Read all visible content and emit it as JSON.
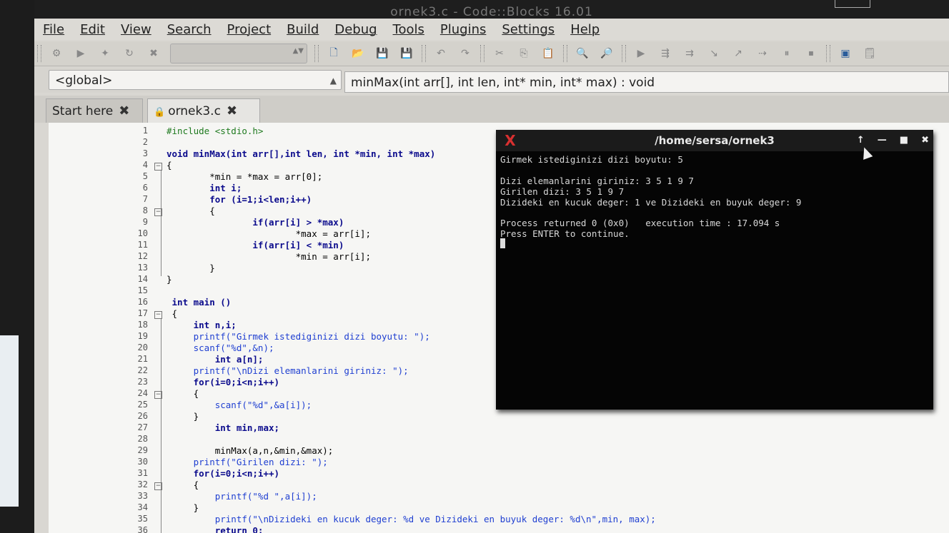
{
  "window": {
    "title": "ornek3.c - Code::Blocks 16.01"
  },
  "menu": [
    "File",
    "Edit",
    "View",
    "Search",
    "Project",
    "Build",
    "Debug",
    "Tools",
    "Plugins",
    "Settings",
    "Help"
  ],
  "scope": {
    "global": "<global>",
    "function": "minMax(int arr[], int len, int* min, int* max) : void"
  },
  "tabs": [
    {
      "label": "Start here"
    },
    {
      "label": "ornek3.c"
    }
  ],
  "code_lines": [
    "#include <stdio.h>",
    "",
    "void minMax(int arr[],int len, int *min, int *max)",
    "{",
    "        *min = *max = arr[0];",
    "        int i;",
    "        for (i=1;i<len;i++)",
    "        {",
    "                if(arr[i] > *max)",
    "                        *max = arr[i];",
    "                if(arr[i] < *min)",
    "                        *min = arr[i];",
    "        }",
    "}",
    "",
    " int main ()",
    " {",
    "     int n,i;",
    "     printf(\"Girmek istediginizi dizi boyutu: \");",
    "     scanf(\"%d\",&n);",
    "         int a[n];",
    "     printf(\"\\nDizi elemanlarini giriniz: \");",
    "     for(i=0;i<n;i++)",
    "     {",
    "         scanf(\"%d\",&a[i]);",
    "     }",
    "         int min,max;",
    "",
    "         minMax(a,n,&min,&max);",
    "     printf(\"Girilen dizi: \");",
    "     for(i=0;i<n;i++)",
    "     {",
    "         printf(\"%d \",a[i]);",
    "     }",
    "         printf(\"\\nDizideki en kucuk deger: %d ve Dizideki en buyuk deger: %d\\n\",min, max);",
    "         return 0;",
    " }",
    ""
  ],
  "terminal": {
    "title": "/home/sersa/ornek3",
    "lines": [
      "Girmek istediginizi dizi boyutu: 5",
      "",
      "Dizi elemanlarini giriniz: 3 5 1 9 7",
      "Girilen dizi: 3 5 1 9 7",
      "Dizideki en kucuk deger: 1 ve Dizideki en buyuk deger: 9",
      "",
      "Process returned 0 (0x0)   execution time : 17.094 s",
      "Press ENTER to continue."
    ]
  },
  "icons": [
    "gear-icon",
    "run-icon",
    "build-icon",
    "rebuild-icon",
    "abort-icon",
    "new-file-icon",
    "open-icon",
    "save-icon",
    "save-all-icon",
    "undo-icon",
    "redo-icon",
    "cut-icon",
    "copy-icon",
    "paste-icon",
    "find-icon",
    "replace-icon",
    "debug-run-icon",
    "debug-step-icon",
    "debug-next-icon",
    "debug-step-in-icon",
    "debug-step-out-icon",
    "debug-break-icon",
    "debug-pause-icon",
    "debug-stop-icon",
    "debug-windows-icon",
    "info-icon"
  ]
}
